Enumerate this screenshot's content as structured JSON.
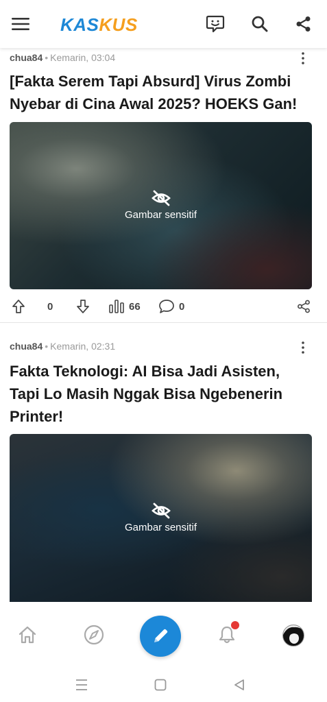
{
  "app": {
    "logo_part1": "KAS",
    "logo_part2": "KUS",
    "brand_colors": {
      "blue": "#1e88d6",
      "orange": "#f59f1f"
    }
  },
  "topbar": {
    "icons": [
      "menu-icon",
      "chat-icon",
      "search-icon",
      "share-icon"
    ]
  },
  "posts": [
    {
      "author": "chua84",
      "separator": "•",
      "time": "Kemarin, 03:04",
      "title": "[Fakta Serem Tapi Absurd] Virus Zombi Nyebar di Cina Awal 2025? HOEKS Gan!",
      "media_label": "Gambar sensitif",
      "upvotes": "0",
      "views": "66",
      "comments": "0"
    },
    {
      "author": "chua84",
      "separator": "•",
      "time": "Kemarin, 02:31",
      "title": "Fakta Teknologi: AI Bisa Jadi Asisten, Tapi Lo Masih Nggak Bisa Ngebenerin Printer!",
      "media_label": "Gambar sensitif"
    }
  ],
  "bottom_nav": {
    "items": [
      "home-icon",
      "explore-icon",
      "create-post-icon",
      "notification-icon",
      "profile-avatar"
    ],
    "accent": "#1c88d8",
    "notification_dot_color": "#e53935"
  },
  "system_nav": {
    "items": [
      "recent-apps-icon",
      "home-button-icon",
      "back-icon"
    ]
  }
}
